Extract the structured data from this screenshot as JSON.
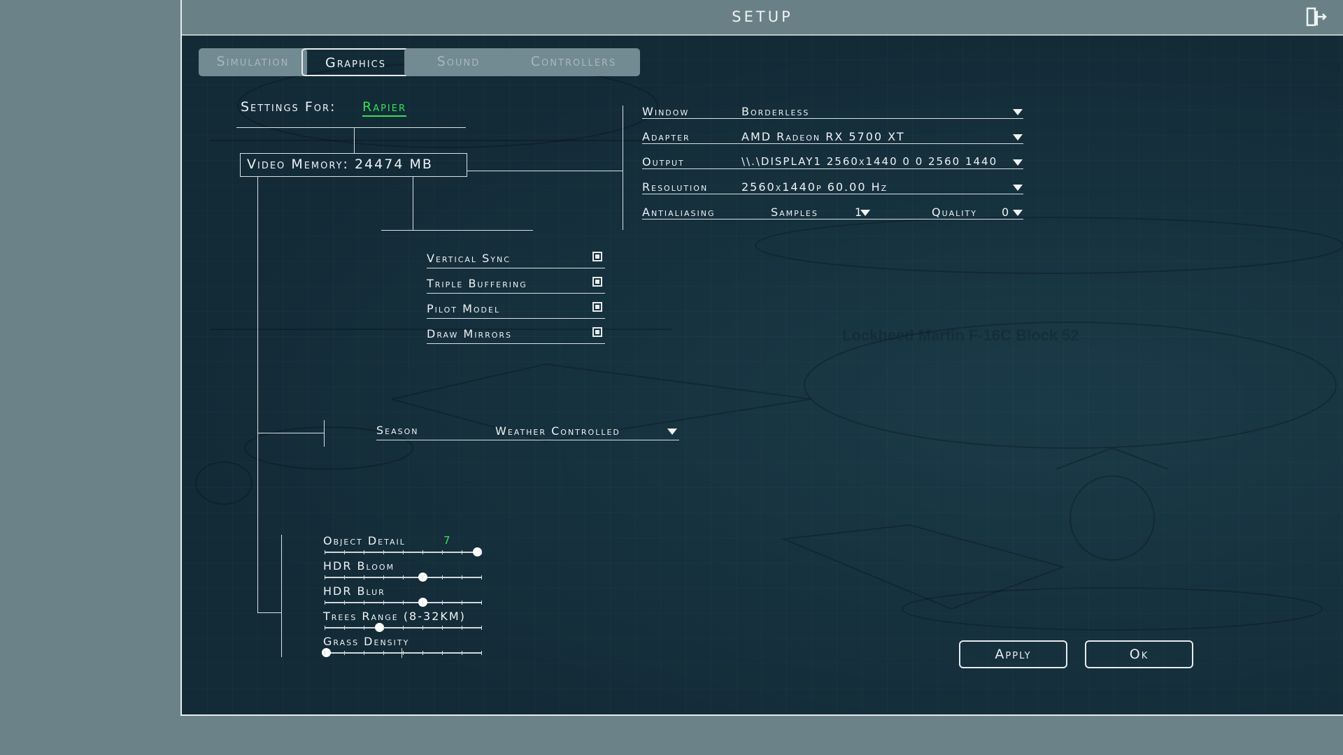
{
  "window": {
    "title": "SETUP",
    "exit_icon": "exit-door-icon"
  },
  "tabs": [
    {
      "label": "Simulation",
      "state": "inactive"
    },
    {
      "label": "Graphics",
      "state": "active"
    },
    {
      "label": "Sound",
      "state": "inactive"
    },
    {
      "label": "Controllers",
      "state": "inactive"
    }
  ],
  "settings_for": {
    "label": "Settings For:",
    "value": "Rapier"
  },
  "video_memory": "Video Memory: 24474 MB",
  "display": {
    "window": {
      "label": "Window",
      "value": "Borderless"
    },
    "adapter": {
      "label": "Adapter",
      "value": "AMD Radeon RX 5700 XT"
    },
    "output": {
      "label": "Output",
      "value": "\\\\.\\DISPLAY1 2560x1440 0 0 2560 1440"
    },
    "resolution": {
      "label": "Resolution",
      "value": "2560x1440p 60.00 Hz"
    },
    "antialiasing": {
      "label": "Antialiasing",
      "samples_label": "Samples",
      "samples_value": "1",
      "quality_label": "Quality",
      "quality_value": "0"
    }
  },
  "toggles": [
    {
      "label": "Vertical Sync",
      "checked": true
    },
    {
      "label": "Triple Buffering",
      "checked": true
    },
    {
      "label": "Pilot Model",
      "checked": true
    },
    {
      "label": "Draw Mirrors",
      "checked": true
    }
  ],
  "season": {
    "label": "Season",
    "value": "Weather Controlled"
  },
  "sliders": {
    "object_detail": {
      "label": "Object Detail",
      "value": "7",
      "position": 1.0
    },
    "hdr_bloom": {
      "label": "HDR Bloom",
      "position": 0.67
    },
    "hdr_blur": {
      "label": "HDR Blur",
      "position": 0.67
    },
    "trees_range": {
      "label": "Trees Range (8-32KM)",
      "position": 0.4
    },
    "grass_density": {
      "label": "Grass Density",
      "position": 0.0
    }
  },
  "buttons": {
    "apply": "Apply",
    "ok": "Ok"
  },
  "background": {
    "watermark": "Lockheed Martin F-16C Block 52"
  },
  "colors": {
    "background": "#16303d",
    "accent_green": "#36e05a",
    "titlebar": "#6a8087",
    "tab_inactive": "#728a91"
  }
}
